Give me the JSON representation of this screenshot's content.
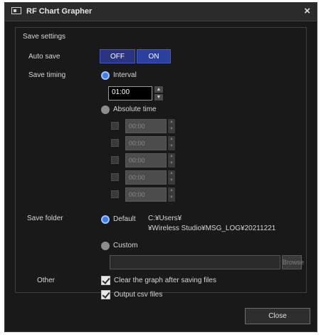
{
  "window": {
    "title": "RF Chart Grapher",
    "close_glyph": "×"
  },
  "save_settings": {
    "group_title": "Save settings",
    "auto_save": {
      "label": "Auto save",
      "off_label": "OFF",
      "on_label": "ON",
      "selected": "OFF"
    },
    "save_timing": {
      "label": "Save timing",
      "interval_label": "Interval",
      "interval_value": "01:00",
      "absolute_time_label": "Absolute time",
      "absolute_times": [
        "00:00",
        "00:00",
        "00:00",
        "00:00",
        "00:00"
      ],
      "selected": "Interval"
    },
    "save_folder": {
      "label": "Save folder",
      "default_label": "Default",
      "default_path_line1": "C:¥Users¥",
      "default_path_line2": "¥Wireless Studio¥MSG_LOG¥20211221",
      "custom_label": "Custom",
      "custom_path_value": "",
      "browse_label": "Browse",
      "selected": "Default"
    },
    "other": {
      "label": "Other",
      "clear_graph_label": "Clear the graph after saving files",
      "clear_graph_checked": true,
      "output_csv_label": "Output csv files",
      "output_csv_checked": true
    }
  },
  "footer": {
    "close_label": "Close"
  },
  "icons": {
    "app_icon": "window-icon",
    "spin_up": "▲",
    "spin_down": "▼"
  },
  "colors": {
    "window_bg": "#191919",
    "toggle_bg": "#2c3f9e",
    "radio_selected": "#3f7ee8"
  }
}
